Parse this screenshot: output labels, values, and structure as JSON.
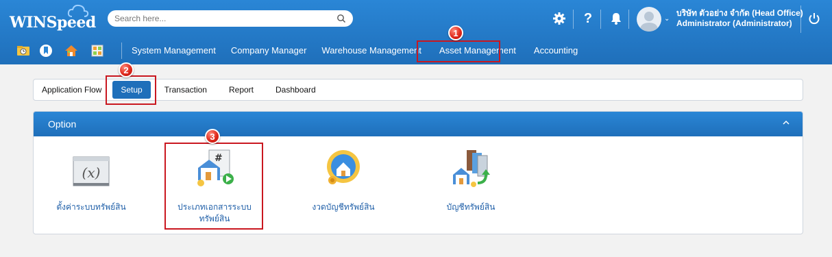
{
  "header": {
    "logo_text": "WINSpeed",
    "search_placeholder": "Search here...",
    "user": {
      "company": "บริษัท ตัวอย่าง จำกัด (Head Office)",
      "role": "Administrator (Administrator)"
    }
  },
  "nav": {
    "menu": [
      {
        "label": "System Management"
      },
      {
        "label": "Company Manager"
      },
      {
        "label": "Warehouse Management"
      },
      {
        "label": "Asset Management"
      },
      {
        "label": "Accounting"
      }
    ]
  },
  "tabs": [
    {
      "label": "Application Flow"
    },
    {
      "label": "Setup"
    },
    {
      "label": "Transaction"
    },
    {
      "label": "Report"
    },
    {
      "label": "Dashboard"
    }
  ],
  "panel": {
    "title": "Option",
    "options": [
      {
        "label": "ตั้งค่าระบบทรัพย์สิน",
        "icon": "variable-fx-icon"
      },
      {
        "label": "ประเภทเอกสารระบบ ทรัพย์สิน",
        "icon": "document-type-icon"
      },
      {
        "label": "งวดบัญชีทรัพย์สิน",
        "icon": "asset-period-icon"
      },
      {
        "label": "บัญชีทรัพย์สิน",
        "icon": "asset-account-icon"
      }
    ]
  },
  "markers": [
    "1",
    "2",
    "3"
  ],
  "colors": {
    "header_blue": "#1f6fba",
    "highlight_red": "#c9171f",
    "link_blue": "#1f5fa8"
  }
}
